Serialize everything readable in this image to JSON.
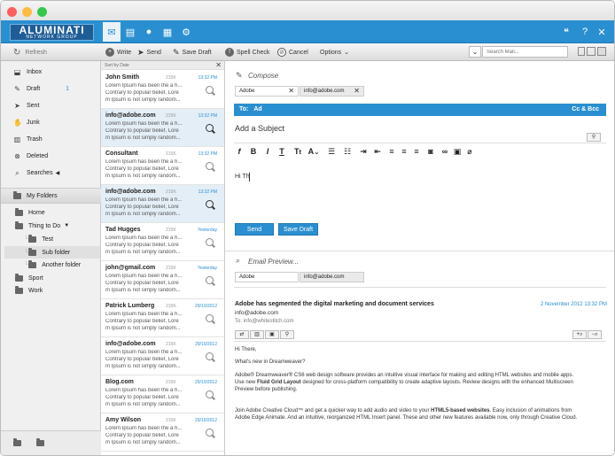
{
  "window": {
    "colors": {
      "close": "#fc605c",
      "minimize": "#fdbc40",
      "maximize": "#34c84a",
      "accent": "#2a8fd0"
    }
  },
  "brand": {
    "name": "ALUMINATI",
    "sub": "NETWORK GROUP"
  },
  "toolbar": {
    "refresh": "Refresh",
    "write": "Write",
    "send": "Send",
    "save_draft": "Save Draft",
    "spell_check": "Spell Check",
    "cancel": "Cancel",
    "options": "Options",
    "search_placeholder": "Search Mail..."
  },
  "sidebar": {
    "items": [
      {
        "label": "Inbox",
        "icon": "inbox-icon"
      },
      {
        "label": "Draft",
        "icon": "draft-icon",
        "count": "1"
      },
      {
        "label": "Sent",
        "icon": "sent-icon"
      },
      {
        "label": "Junk",
        "icon": "junk-icon"
      },
      {
        "label": "Trash",
        "icon": "trash-icon"
      },
      {
        "label": "Deleted",
        "icon": "deleted-icon"
      },
      {
        "label": "Searches",
        "icon": "search-icon"
      }
    ],
    "my_folders": "My Folders",
    "tree": {
      "home": "Home",
      "thing_to_do": "Thing to Do",
      "test": "Test",
      "sub_folder": "Sub folder",
      "another_folder": "Another folder",
      "sport": "Sport",
      "work": "Work"
    }
  },
  "list": {
    "sort_label": "Sort by Date",
    "mails": [
      {
        "from": "John Smith",
        "size": "215K",
        "date": "13:32 PM",
        "l1": "Lorem Ipsum has been the a h...",
        "l2": "Contrary to popular belief, Lore",
        "l3": "m Ipsum is not simply random..."
      },
      {
        "from": "info@adobe.com",
        "size": "215K",
        "date": "13:32 PM",
        "l1": "Lorem Ipsum has been the a h...",
        "l2": "Contrary to popular belief, Lore",
        "l3": "m Ipsum is not simply random..."
      },
      {
        "from": "Consultant",
        "size": "215K",
        "date": "13:32 PM",
        "l1": "Lorem Ipsum has been the a h...",
        "l2": "Contrary to popular belief, Lore",
        "l3": "m Ipsum is not simply random..."
      },
      {
        "from": "info@adobe.com",
        "size": "215K",
        "date": "13:32 PM",
        "l1": "Lorem Ipsum has been the a h...",
        "l2": "Contrary to popular belief, Lore",
        "l3": "m Ipsum is not simply random..."
      },
      {
        "from": "Tad Hugges",
        "size": "215K",
        "date": "Yesterday",
        "l1": "Lorem Ipsum has been the a h...",
        "l2": "Contrary to popular belief, Lore",
        "l3": "m Ipsum is not simply random..."
      },
      {
        "from": "john@gmail.com",
        "size": "215K",
        "date": "Yesterday",
        "l1": "Lorem Ipsum has been the a h...",
        "l2": "Contrary to popular belief, Lore",
        "l3": "m Ipsum is not simply random..."
      },
      {
        "from": "Patrick Lumberg",
        "size": "215K",
        "date": "29/10/2012",
        "l1": "Lorem Ipsum has been the a h...",
        "l2": "Contrary to popular belief, Lore",
        "l3": "m Ipsum is not simply random..."
      },
      {
        "from": "info@adobe.com",
        "size": "215K",
        "date": "29/10/2012",
        "l1": "Lorem Ipsum has been the a h...",
        "l2": "Contrary to popular belief, Lore",
        "l3": "m Ipsum is not simply random..."
      },
      {
        "from": "Blog.com",
        "size": "215K",
        "date": "29/10/2012",
        "l1": "Lorem Ipsum has been the a h...",
        "l2": "Contrary to popular belief, Lore",
        "l3": "m Ipsum is not simply random..."
      },
      {
        "from": "Amy Wilson",
        "size": "215K",
        "date": "29/10/2012",
        "l1": "Lorem Ipsum has been the a h...",
        "l2": "Contrary to popular belief, Lore",
        "l3": "m Ipsum is not simply random..."
      }
    ]
  },
  "compose": {
    "title": "Compose",
    "to_chips": [
      "Adobe",
      "info@adobe.com"
    ],
    "to_label": "To:",
    "to_value": "Ad",
    "cc_bcc": "Cc & Bcc",
    "subject_placeholder": "Add a Subject",
    "body": "Hi Th",
    "send": "Send",
    "save_draft": "Save Draft"
  },
  "preview": {
    "title": "Email Preview...",
    "chips": [
      "Adobe",
      "info@adobe.com"
    ],
    "subject": "Adobe has segmented the digital marketing and document services",
    "date": "2 November 2012 13:32 PM",
    "from": "info@adobe.com",
    "to": "To: info@whitestitch.com",
    "greeting": "Hi There,",
    "line1": "What's new in Dreamweaver?",
    "p1a": "Adobe® Dreamweaver® CS6 web design software provides an intuitive visual interface for making and editing HTML websites and mobile apps.",
    "p1b_pre": "Use new ",
    "p1b_bold": "Fluid Grid Layout",
    "p1b_post": " designed for cross-platform compatibility to create adaptive layouts. Review designs with the enhanced Multiscreen",
    "p1c": "Preview before publishing.",
    "p2a_pre": "Join Adobe Creative Cloud™ and get a quicker way to add audio and video to your ",
    "p2a_bold": "HTML5-based websites",
    "p2a_post": ".  Easy inclusion of animations from",
    "p2b": "Adobe Edge Animate. And an intuitive, reorganized HTML Insert panel. These and other new features available now, only through Creative Cloud."
  }
}
